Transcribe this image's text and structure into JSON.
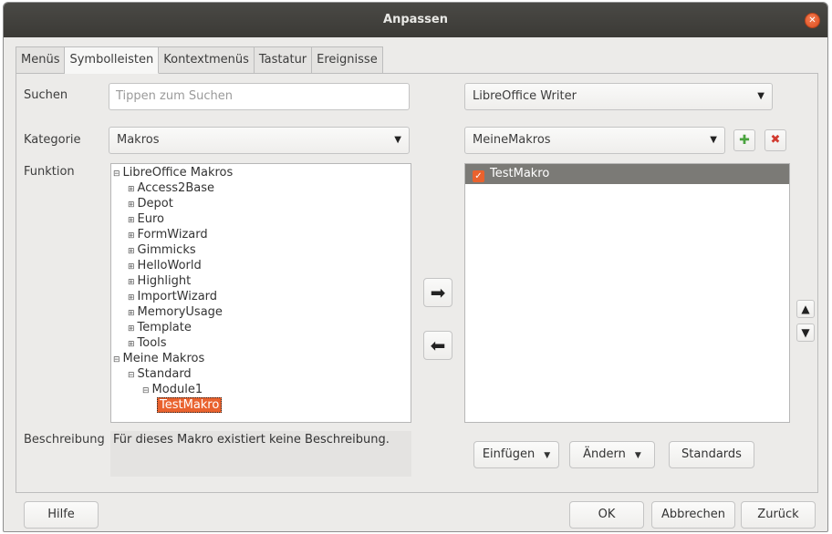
{
  "window": {
    "title": "Anpassen"
  },
  "tabs": [
    "Menüs",
    "Symbolleisten",
    "Kontextmenüs",
    "Tastatur",
    "Ereignisse"
  ],
  "labels": {
    "search": "Suchen",
    "category": "Kategorie",
    "function": "Funktion",
    "description": "Beschreibung"
  },
  "search": {
    "placeholder": "Tippen zum Suchen"
  },
  "category": {
    "value": "Makros"
  },
  "target": {
    "app": "LibreOffice Writer",
    "toolbar": "MeineMakros"
  },
  "tree": [
    "LibreOffice Makros",
    "Access2Base",
    "Depot",
    "Euro",
    "FormWizard",
    "Gimmicks",
    "HelloWorld",
    "Highlight",
    "ImportWizard",
    "MemoryUsage",
    "Template",
    "Tools",
    "Meine Makros",
    "Standard",
    "Module1",
    "TestMakro"
  ],
  "toolbar_entries": [
    {
      "label": "TestMakro",
      "checked": true
    }
  ],
  "description_text": "Für dieses Makro existiert keine Beschreibung.",
  "buttons": {
    "insert": "Einfügen",
    "modify": "Ändern",
    "defaults": "Standards",
    "help": "Hilfe",
    "ok": "OK",
    "cancel": "Abbrechen",
    "reset": "Zurück"
  },
  "icons": {
    "close": "close-icon",
    "add": "plus-icon",
    "remove": "x-icon",
    "move_right": "arrow-right-icon",
    "move_left": "arrow-left-icon",
    "move_up": "arrow-up-icon",
    "move_down": "arrow-down-icon"
  },
  "colors": {
    "accent": "#e9622e",
    "selection_row": "#7b7a76",
    "titlebar": "#3b3a36"
  }
}
